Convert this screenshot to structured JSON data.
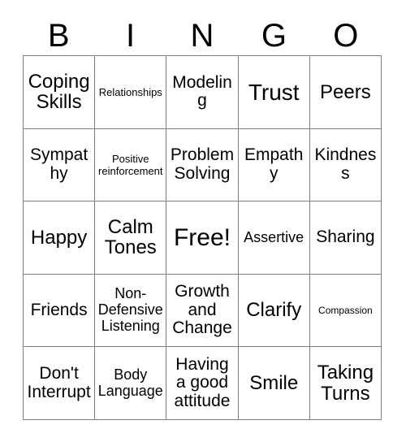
{
  "card": {
    "title": "BINGO",
    "header_letters": [
      "B",
      "I",
      "N",
      "G",
      "O"
    ],
    "free_space_label": "Free!",
    "colors": {
      "background": "#ffffff",
      "text": "#000000",
      "grid_line": "#7f7f7f"
    },
    "grid_size": "5x5",
    "columns": [
      "B",
      "I",
      "N",
      "G",
      "O"
    ],
    "rows": [
      [
        {
          "text": "Coping Skills",
          "size": "lg"
        },
        {
          "text": "Relationships",
          "size": "xs"
        },
        {
          "text": "Modeling",
          "size": "md"
        },
        {
          "text": "Trust",
          "size": "xl"
        },
        {
          "text": "Peers",
          "size": "lg"
        }
      ],
      [
        {
          "text": "Sympathy",
          "size": "md"
        },
        {
          "text": "Positive reinforcement",
          "size": "xs"
        },
        {
          "text": "Problem Solving",
          "size": "md"
        },
        {
          "text": "Empathy",
          "size": "md"
        },
        {
          "text": "Kindness",
          "size": "md"
        }
      ],
      [
        {
          "text": "Happy",
          "size": "lg"
        },
        {
          "text": "Calm Tones",
          "size": "lg"
        },
        {
          "text": "Free!",
          "size": "free"
        },
        {
          "text": "Assertive",
          "size": "sm"
        },
        {
          "text": "Sharing",
          "size": "md"
        }
      ],
      [
        {
          "text": "Friends",
          "size": "md"
        },
        {
          "text": "Non-Defensive Listening",
          "size": "sm"
        },
        {
          "text": "Growth and Change",
          "size": "md"
        },
        {
          "text": "Clarify",
          "size": "lg"
        },
        {
          "text": "Compassion",
          "size": "xxs"
        }
      ],
      [
        {
          "text": "Don't Interrupt",
          "size": "md"
        },
        {
          "text": "Body Language",
          "size": "sm"
        },
        {
          "text": "Having a good attitude",
          "size": "md"
        },
        {
          "text": "Smile",
          "size": "lg"
        },
        {
          "text": "Taking Turns",
          "size": "lg"
        }
      ]
    ]
  }
}
